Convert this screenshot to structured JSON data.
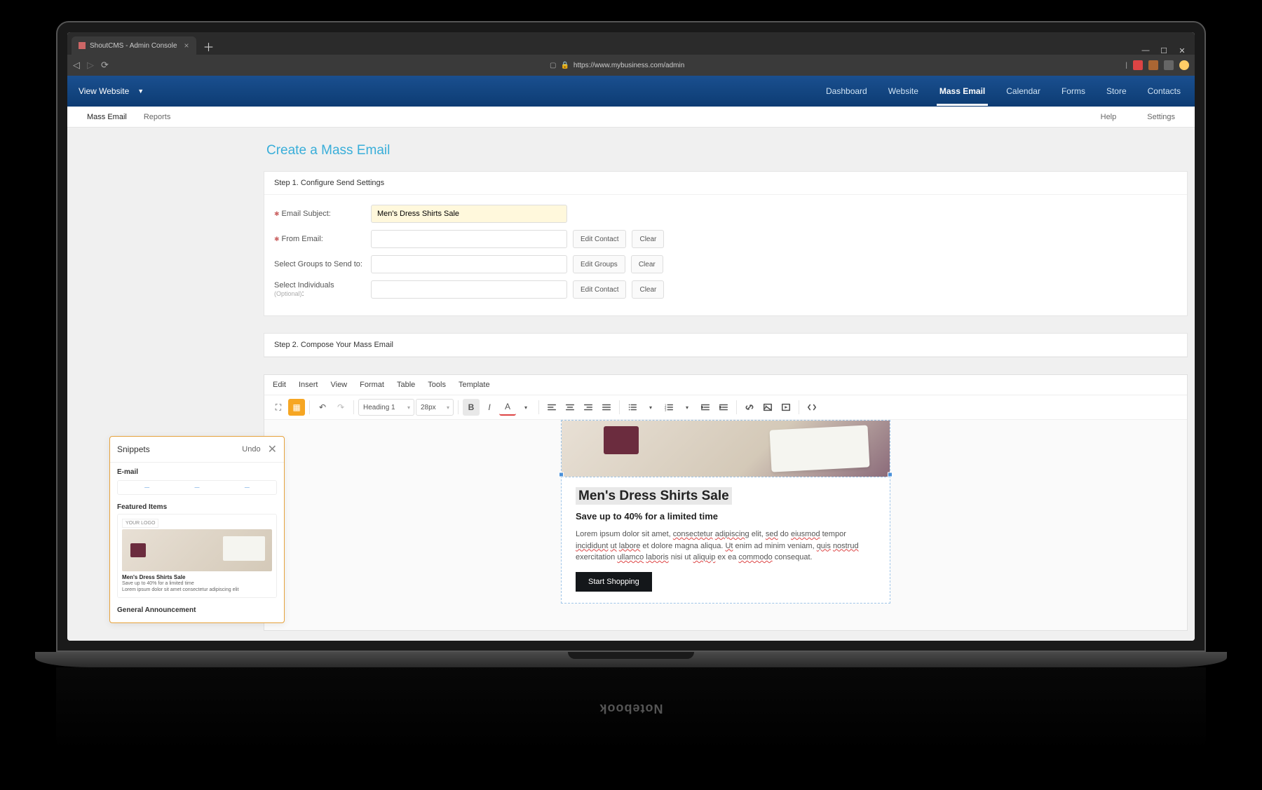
{
  "browser": {
    "tab_title": "ShoutCMS - Admin Console",
    "url": "https://www.mybusiness.com/admin",
    "window_controls": {
      "min": "—",
      "max": "☐",
      "close": "✕"
    }
  },
  "app_header": {
    "view_website": "View Website",
    "nav": [
      "Dashboard",
      "Website",
      "Mass Email",
      "Calendar",
      "Forms",
      "Store",
      "Contacts"
    ],
    "active_nav": "Mass Email"
  },
  "sub_header": {
    "left": [
      "Mass Email",
      "Reports"
    ],
    "active": "Mass Email",
    "right": [
      "Help",
      "Settings"
    ]
  },
  "page": {
    "title": "Create a Mass Email",
    "step1": {
      "head": "Step 1. Configure Send Settings",
      "subject_label": "Email Subject:",
      "subject_value": "Men's Dress Shirts Sale",
      "from_label": "From Email:",
      "groups_label": "Select Groups to Send to:",
      "individuals_label": "Select Individuals",
      "optional": "(Optional)",
      "edit_contact": "Edit Contact",
      "edit_groups": "Edit Groups",
      "clear": "Clear"
    },
    "step2": {
      "head": "Step 2. Compose Your Mass Email"
    }
  },
  "editor": {
    "menu": [
      "Edit",
      "Insert",
      "View",
      "Format",
      "Table",
      "Tools",
      "Template"
    ],
    "heading_sel": "Heading 1",
    "size_sel": "28px"
  },
  "email_content": {
    "h1": "Men's Dress Shirts Sale",
    "h2": "Save up to 40% for a limited time",
    "p1a": "Lorem ipsum dolor sit amet, ",
    "p1b": "consectetur",
    "p1c": " ",
    "p1d": "adipiscing",
    "p1e": " elit, ",
    "p1f": "sed",
    "p1g": " do ",
    "p1h": "eiusmod",
    "p1i": " tempor ",
    "p1j": "incididunt",
    "p1k": " ",
    "p1l": "ut",
    "p1m": " ",
    "p1n": "labore",
    "p1o": " et dolore magna aliqua. ",
    "p1p": "Ut",
    "p1q": " enim ad minim veniam, ",
    "p1r": "quis",
    "p1s": " ",
    "p1t": "nostrud",
    "p1u": " exercitation ",
    "p1v": "ullamco",
    "p1w": " ",
    "p1x": "laboris",
    "p1y": " nisi ut ",
    "p1z": "aliquip",
    "p2a": " ex ea ",
    "p2b": "commodo",
    "p2c": " consequat.",
    "cta": "Start Shopping"
  },
  "snippets": {
    "title": "Snippets",
    "undo": "Undo",
    "cat": "E-mail",
    "sec_featured": "Featured Items",
    "your_logo": "YOUR LOGO",
    "t1": "Men's Dress Shirts Sale",
    "t2": "Save up to 40% for a limited time",
    "t3": "Lorem ipsum dolor sit amet consectetur adipiscing elit",
    "sec_general": "General Announcement"
  },
  "notebook": "Notebook"
}
